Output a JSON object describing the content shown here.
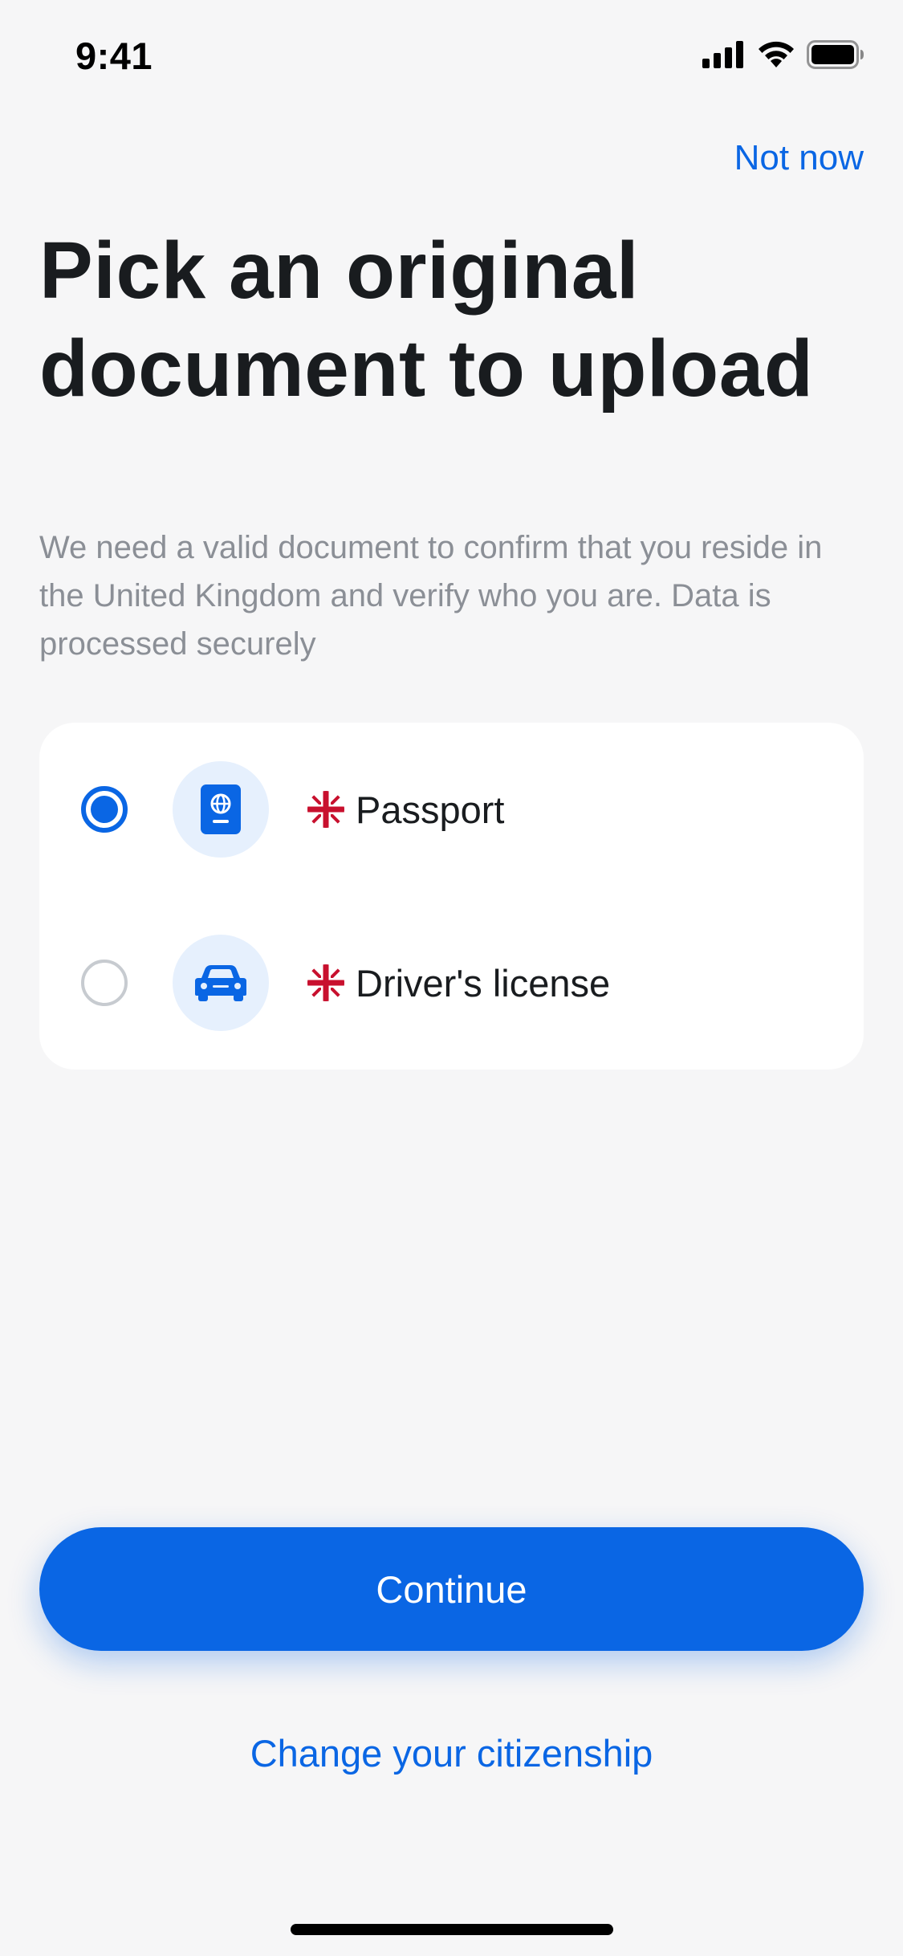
{
  "status_bar": {
    "time": "9:41",
    "icons": [
      "cellular-signal-icon",
      "wifi-icon",
      "battery-icon"
    ]
  },
  "header": {
    "not_now_label": "Not now"
  },
  "main": {
    "title": "Pick an original document to upload",
    "subtitle": "We need a valid document to confirm that you reside in the United Kingdom and verify who you are. Data is processed securely"
  },
  "options": [
    {
      "label": "Passport",
      "icon": "passport-icon",
      "flag": "uk-flag-icon",
      "selected": true
    },
    {
      "label": "Driver's license",
      "icon": "car-icon",
      "flag": "uk-flag-icon",
      "selected": false
    }
  ],
  "actions": {
    "continue_label": "Continue",
    "change_citizenship_label": "Change your citizenship"
  },
  "colors": {
    "accent": "#0a66e4",
    "background": "#f6f6f7",
    "icon_bg": "#e6f0fd",
    "text_primary": "#191c1f",
    "text_secondary": "#8b8f96"
  }
}
